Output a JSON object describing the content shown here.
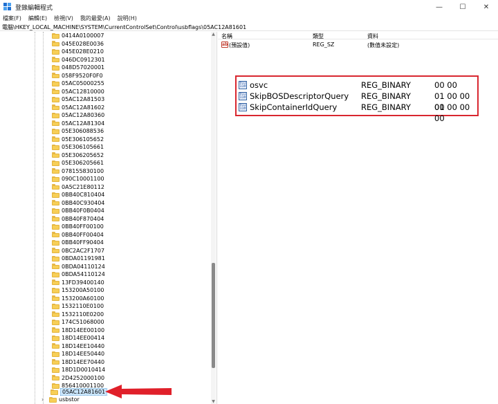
{
  "window": {
    "title": "登錄編輯程式",
    "controls": {
      "minimize": "—",
      "maximize": "☐",
      "close": "✕"
    }
  },
  "menu": [
    "檔案(F)",
    "編輯(E)",
    "檢視(V)",
    "我的最愛(A)",
    "說明(H)"
  ],
  "address": "電腦\\HKEY_LOCAL_MACHINE\\SYSTEM\\CurrentControlSet\\Control\\usbflags\\05AC12A81601",
  "tree": {
    "keys": [
      "0414A0100007",
      "045E028E0036",
      "045E028E0210",
      "046DC0912301",
      "048D57020001",
      "058F9520F0F0",
      "05AC05000255",
      "05AC12810000",
      "05AC12A81503",
      "05AC12A81602",
      "05AC12A80360",
      "05AC12A81304",
      "05E306088536",
      "05E306105652",
      "05E306105661",
      "05E306205652",
      "05E306205661",
      "078155830100",
      "090C10001100",
      "0A5C21E80112",
      "0BB40C810404",
      "0BB40C930404",
      "0BB40F0B0404",
      "0BB40F870404",
      "0BB40FF00100",
      "0BB40FF00404",
      "0BB40FF90404",
      "0BC2AC2F1707",
      "0BDA01191981",
      "0BDA04110124",
      "0BDA54110124",
      "13FD39400140",
      "153200A50100",
      "153200A60100",
      "1532110E0100",
      "1532110E0200",
      "174C51068000",
      "18D14EE00100",
      "18D14EE00414",
      "18D14EE10440",
      "18D14EE50440",
      "18D14EE70440",
      "18D1D0010414",
      "2D4252000100",
      "856410001100"
    ],
    "selected": "05AC12A81601",
    "sibling": "usbstor",
    "sibling_expander": "›"
  },
  "values": {
    "headers": {
      "name": "名稱",
      "type": "類型",
      "data": "資料"
    },
    "default_row": {
      "name": "(預設值)",
      "type": "REG_SZ",
      "data": "(數值未設定)"
    },
    "binary_rows": [
      {
        "name": "osvc",
        "type": "REG_BINARY",
        "data": "00 00"
      },
      {
        "name": "SkipBOSDescriptorQuery",
        "type": "REG_BINARY",
        "data": "01 00 00 00"
      },
      {
        "name": "SkipContainerIdQuery",
        "type": "REG_BINARY",
        "data": "01 00 00 00"
      }
    ]
  },
  "icons": {
    "string_value": "ab",
    "binary_value": "011 110"
  },
  "colors": {
    "highlight_border": "#d8262f",
    "arrow": "#e0202a",
    "folder": "#f7cf57",
    "selection": "#cce8ff"
  }
}
